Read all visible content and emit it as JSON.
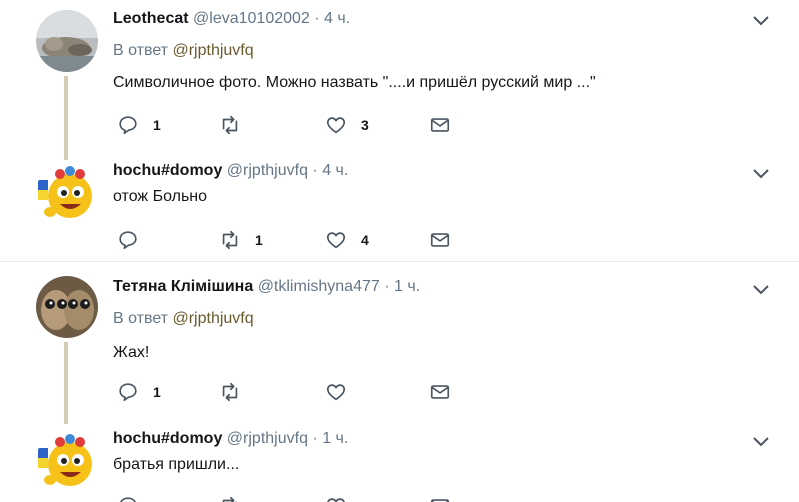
{
  "ui": {
    "separator": "·",
    "in_reply_label": "В ответ"
  },
  "colors": {
    "thread_line": "#d6cbb3",
    "mention": "#6b5a2e",
    "muted": "#657786",
    "icon": "#4a5560"
  },
  "tweets": [
    {
      "name": "Leothecat",
      "handle": "@leva10102002",
      "time": "4 ч.",
      "reply_to": "@rjpthjuvfq",
      "text": "Символичное фото. Можно назвать \"....и пришёл русский мир ...\"",
      "avatar_icon": "cat-photo-avatar",
      "replies": "1",
      "retweets": "",
      "likes": "3"
    },
    {
      "name": "hochu#domoy",
      "handle": "@rjpthjuvfq",
      "time": "4 ч.",
      "reply_to": "",
      "text": "отож  Больно",
      "avatar_icon": "emoji-with-flag-avatar",
      "replies": "",
      "retweets": "1",
      "likes": "4"
    },
    {
      "name": "Тетяна Клімішина",
      "handle": "@tklimishyna477",
      "time": "1 ч.",
      "reply_to": "@rjpthjuvfq",
      "text": "Жах!",
      "avatar_icon": "owls-photo-avatar",
      "replies": "1",
      "retweets": "",
      "likes": ""
    },
    {
      "name": "hochu#domoy",
      "handle": "@rjpthjuvfq",
      "time": "1 ч.",
      "reply_to": "",
      "text": "братья пришли...",
      "avatar_icon": "emoji-with-flag-avatar",
      "replies": "",
      "retweets": "",
      "likes": ""
    }
  ]
}
